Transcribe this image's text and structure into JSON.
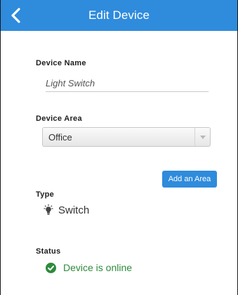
{
  "header": {
    "title": "Edit Device",
    "back_icon": "chevron-left-icon",
    "color": "#2f8bdc"
  },
  "form": {
    "device_name": {
      "label": "Device Name",
      "value": "Light Switch"
    },
    "device_area": {
      "label": "Device Area",
      "selected": "Office"
    },
    "add_area_button": "Add an Area",
    "type": {
      "label": "Type",
      "icon": "lightbulb-icon",
      "value": "Switch"
    },
    "status": {
      "label": "Status",
      "icon": "check-circle-icon",
      "value": "Device is online",
      "color": "#2e8a3c"
    }
  }
}
